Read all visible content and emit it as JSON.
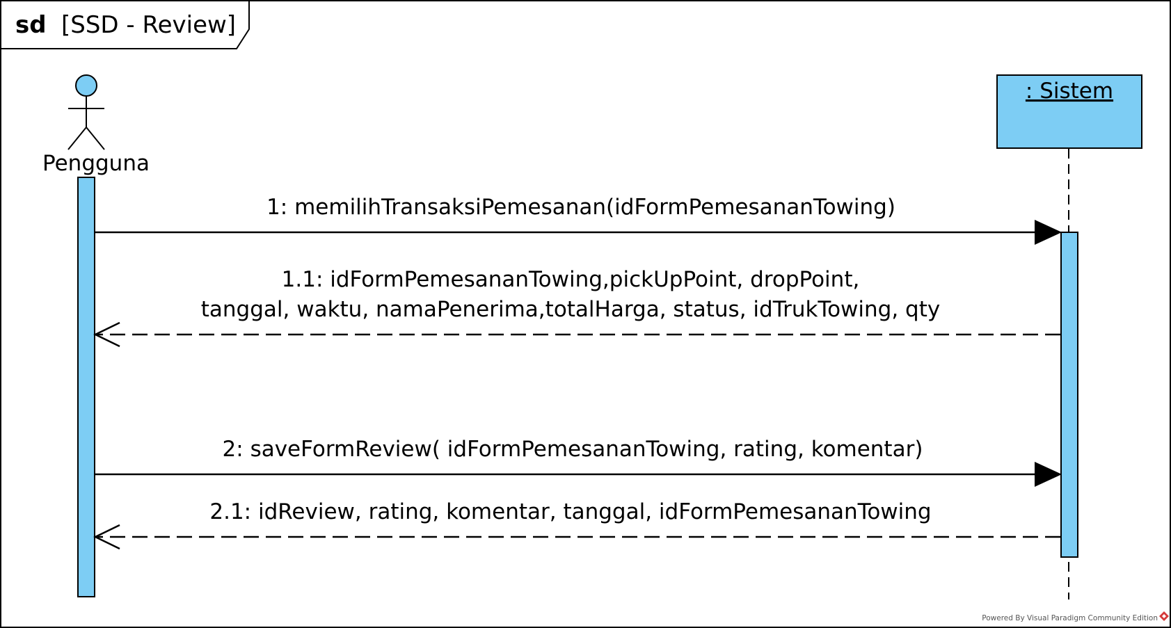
{
  "frame": {
    "keyword": "sd",
    "title": "[SSD - Review]"
  },
  "lifelines": {
    "actor": {
      "name": "Pengguna",
      "type": "actor"
    },
    "system": {
      "name": ": Sistem",
      "type": "object"
    }
  },
  "messages": [
    {
      "label": "1: memilihTransaksiPemesanan(idFormPemesananTowing)",
      "kind": "synchronous",
      "direction": "Pengguna → Sistem"
    },
    {
      "label_lines": [
        "1.1: idFormPemesananTowing,pickUpPoint, dropPoint,",
        "tanggal, waktu, namaPenerima,totalHarga, status, idTrukTowing, qty"
      ],
      "kind": "return",
      "direction": "Sistem → Pengguna"
    },
    {
      "label": "2: saveFormReview( idFormPemesananTowing, rating, komentar)",
      "kind": "synchronous",
      "direction": "Pengguna → Sistem"
    },
    {
      "label": "2.1: idReview, rating, komentar, tanggal, idFormPemesananTowing",
      "kind": "return",
      "direction": "Sistem → Pengguna"
    }
  ],
  "footer": {
    "credit": "Powered By Visual Paradigm Community Edition"
  },
  "colors": {
    "fill": "#7dcdf4",
    "stroke": "#000000",
    "logo": "#d63a3a"
  }
}
